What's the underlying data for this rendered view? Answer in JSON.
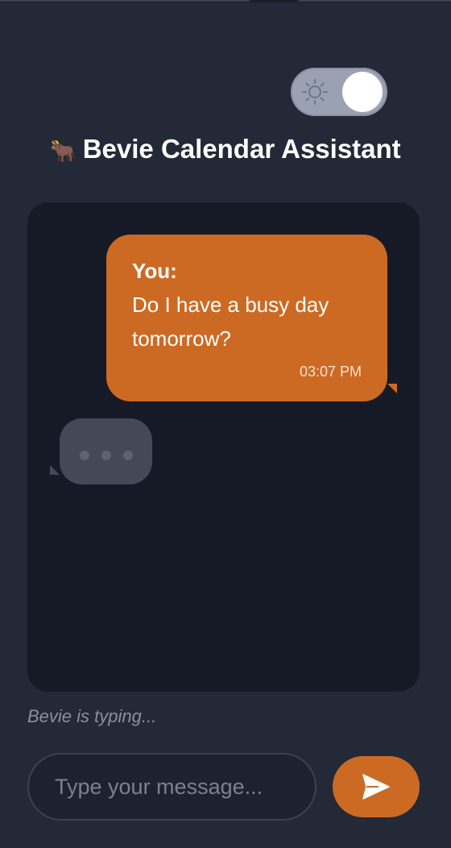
{
  "header": {
    "title": "Bevie Calendar Assistant",
    "title_emoji": "🐂",
    "theme_toggle": {
      "icon": "sun-icon",
      "state": "light"
    }
  },
  "chat": {
    "messages": [
      {
        "sender": "You:",
        "text": "Do I have a busy day tomorrow?",
        "time": "03:07 PM"
      }
    ],
    "typing_indicator_dots": 3
  },
  "status": {
    "typing_text": "Bevie is typing..."
  },
  "composer": {
    "placeholder": "Type your message...",
    "value": "",
    "send_icon": "send-icon"
  },
  "colors": {
    "background": "#232936",
    "chat_background": "#151a26",
    "accent": "#cc6a24",
    "bot_bubble": "#434957"
  }
}
